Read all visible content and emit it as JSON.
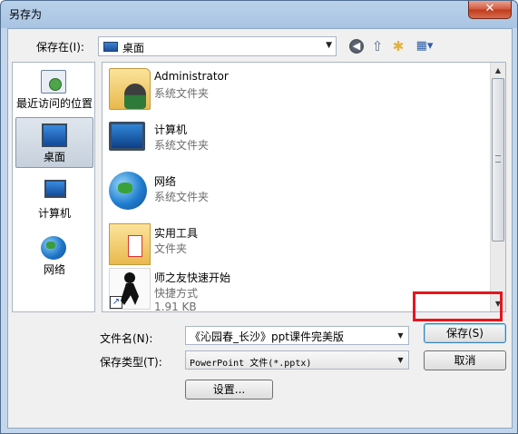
{
  "window": {
    "title": "另存为",
    "close_label": "✕"
  },
  "toolbar": {
    "save_in_label": "保存在(I):",
    "location_value": "桌面",
    "icons": [
      "back-icon",
      "up-folder-icon",
      "new-folder-icon",
      "views-menu-icon"
    ]
  },
  "places": [
    {
      "label": "最近访问的位置",
      "icon": "recent-places-icon",
      "selected": false
    },
    {
      "label": "桌面",
      "icon": "desktop-icon",
      "selected": true
    },
    {
      "label": "计算机",
      "icon": "computer-icon",
      "selected": false
    },
    {
      "label": "网络",
      "icon": "network-icon",
      "selected": false
    }
  ],
  "files": [
    {
      "name": "Administrator",
      "type": "系统文件夹",
      "size": "",
      "icon": "user-folder-icon"
    },
    {
      "name": "计算机",
      "type": "系统文件夹",
      "size": "",
      "icon": "computer-icon"
    },
    {
      "name": "网络",
      "type": "系统文件夹",
      "size": "",
      "icon": "network-globe-icon"
    },
    {
      "name": "实用工具",
      "type": "文件夹",
      "size": "",
      "icon": "folder-icon"
    },
    {
      "name": "师之友快速开始",
      "type": "快捷方式",
      "size": "1.91 KB",
      "icon": "shortcut-runner-icon"
    }
  ],
  "form": {
    "filename_label": "文件名(N):",
    "filename_value": "《沁园春_长沙》ppt课件完美版",
    "filetype_label": "保存类型(T):",
    "filetype_value": "PowerPoint 文件(*.pptx)",
    "save_button": "保存(S)",
    "cancel_button": "取消",
    "settings_button": "设置..."
  },
  "colors": {
    "highlight_border": "#e8141c",
    "close_button": "#c03a1b",
    "title_bar": "#b9d1ea"
  }
}
